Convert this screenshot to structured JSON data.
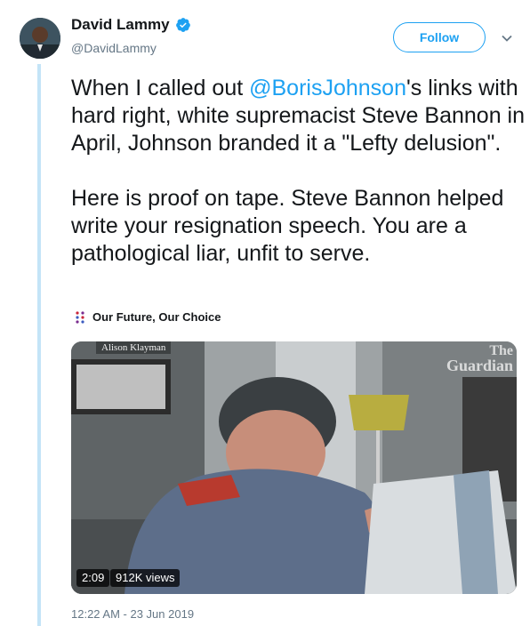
{
  "author": {
    "name": "David Lammy",
    "handle": "@DavidLammy",
    "verified": true
  },
  "follow_label": "Follow",
  "tweet": {
    "line1_pre": "When I called out ",
    "mention": "@BorisJohnson",
    "line1_post": "'s links with hard right, white supremacist Steve Bannon in April, Johnson branded it a \"Lefty delusion\".\n\nHere is proof on tape. Steve Bannon helped write your resignation speech. You are a pathological liar, unfit to serve."
  },
  "event": {
    "label": "Our Future, Our Choice"
  },
  "video": {
    "credit": "Alison Klayman",
    "logo_line1": "The",
    "logo_line2": "Guardian",
    "duration": "2:09",
    "views": "912K views"
  },
  "timestamp": "12:22 AM - 23 Jun 2019",
  "colors": {
    "accent": "#1da1f2",
    "thread_line": "#c4e4f7",
    "secondary_text": "#657786"
  },
  "icons": [
    "verified-badge-icon",
    "chevron-down-icon",
    "event-icon"
  ]
}
